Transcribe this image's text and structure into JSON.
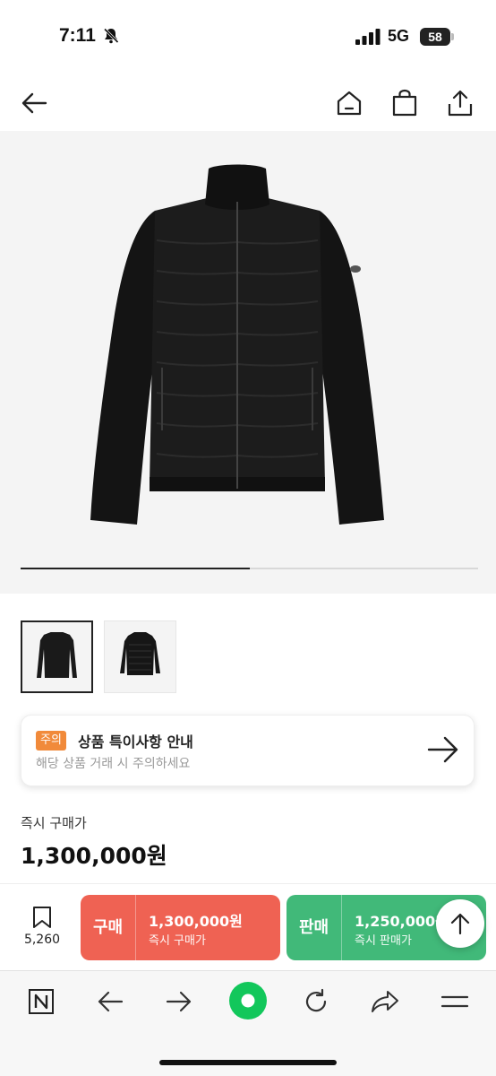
{
  "status_bar": {
    "time": "7:11",
    "network": "5G",
    "battery": "58",
    "icons": [
      "bell-off-icon",
      "signal-icon",
      "battery-icon"
    ]
  },
  "header": {
    "icons": [
      "back-arrow-icon",
      "home-icon",
      "shopping-bag-icon",
      "share-icon"
    ]
  },
  "gallery": {
    "progress_fraction": 0.5,
    "thumbnails": [
      {
        "name": "thumbnail-front",
        "selected": true
      },
      {
        "name": "thumbnail-back",
        "selected": false
      }
    ]
  },
  "notice": {
    "badge": "주의",
    "title": "상품 특이사항 안내",
    "description": "해당 상품 거래 시 주의하세요",
    "icon": "arrow-right-icon"
  },
  "price": {
    "label": "즉시 구매가",
    "value": "1,300,000원"
  },
  "actions": {
    "bookmark_count": "5,260",
    "buy": {
      "kind": "구매",
      "price": "1,300,000원",
      "sub": "즉시 구매가",
      "color": "#ef6253"
    },
    "sell": {
      "kind": "판매",
      "price": "1,250,000원",
      "sub": "즉시 판매가",
      "color": "#41b979"
    }
  },
  "browser_toolbar": {
    "icons": [
      "naver-n-icon",
      "back-icon",
      "forward-icon",
      "green-home-dot-icon",
      "reload-icon",
      "share-arrow-icon",
      "menu-icon"
    ],
    "accent": "#12c75b"
  }
}
